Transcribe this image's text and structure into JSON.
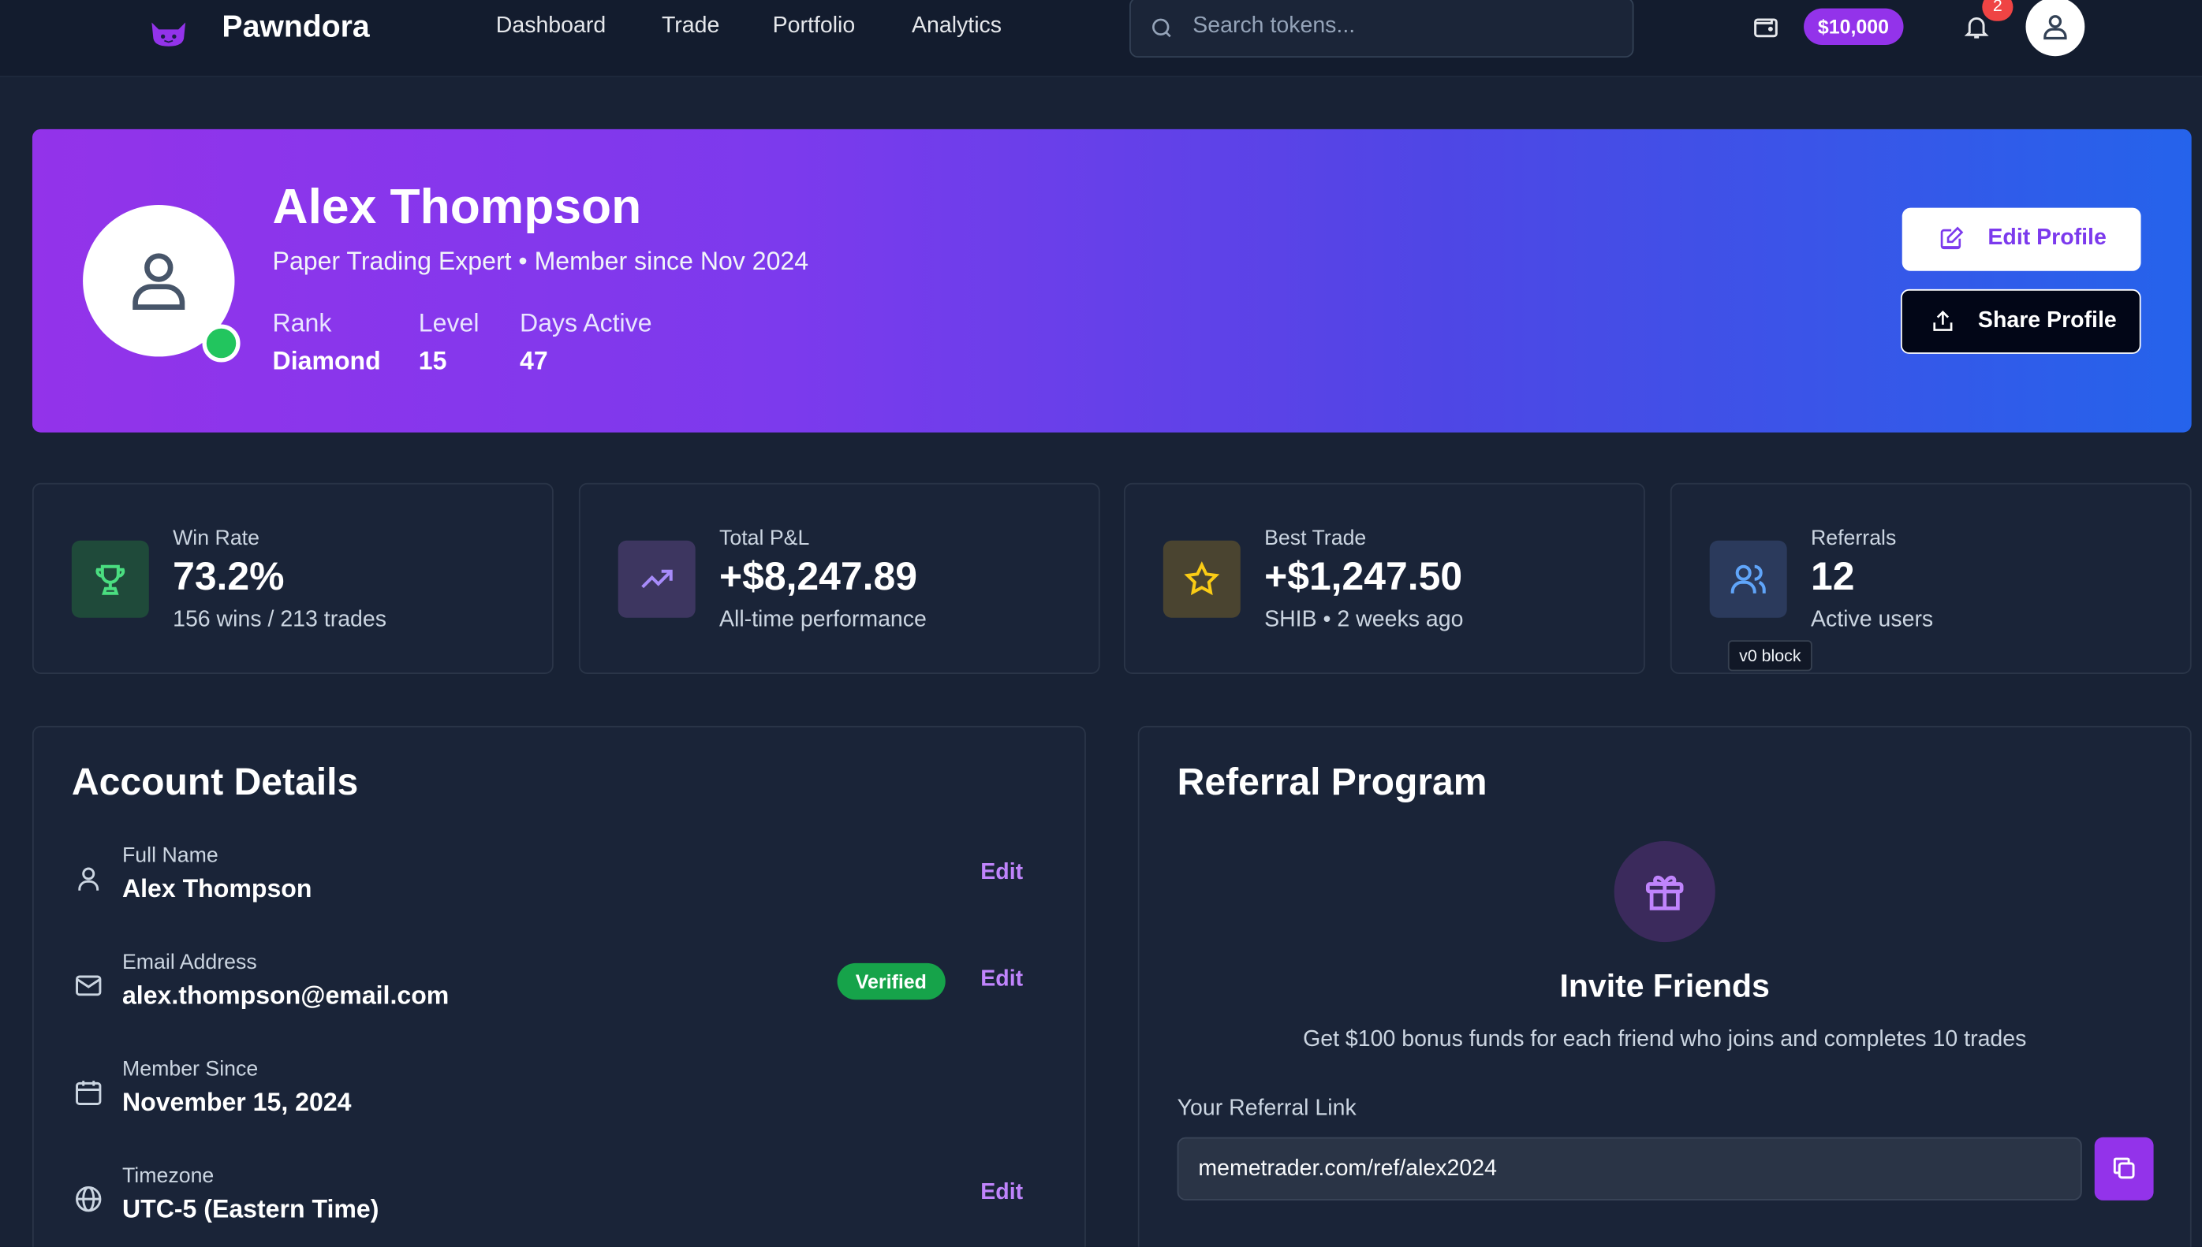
{
  "nav": {
    "brand": "Pawndora",
    "links": [
      "Dashboard",
      "Trade",
      "Portfolio",
      "Analytics"
    ],
    "search_placeholder": "Search tokens...",
    "balance": "$10,000",
    "notification_count": "2"
  },
  "hero": {
    "name": "Alex Thompson",
    "subtitle": "Paper Trading Expert • Member since Nov 2024",
    "stats": [
      {
        "label": "Rank",
        "value": "Diamond"
      },
      {
        "label": "Level",
        "value": "15"
      },
      {
        "label": "Days Active",
        "value": "47"
      }
    ],
    "edit_label": "Edit Profile",
    "share_label": "Share Profile"
  },
  "cards": [
    {
      "label": "Win Rate",
      "value": "73.2%",
      "sub": "156 wins / 213 trades",
      "icon": "trophy-icon",
      "color": "#4ade80"
    },
    {
      "label": "Total P&L",
      "value": "+$8,247.89",
      "sub": "All-time performance",
      "icon": "trending-up-icon",
      "color": "#a78bfa"
    },
    {
      "label": "Best Trade",
      "value": "+$1,247.50",
      "sub": "SHIB • 2 weeks ago",
      "icon": "star-icon",
      "color": "#facc15"
    },
    {
      "label": "Referrals",
      "value": "12",
      "sub": "Active users",
      "icon": "users-icon",
      "color": "#60a5fa"
    }
  ],
  "tooltip": "v0 block",
  "account": {
    "title": "Account Details",
    "rows": [
      {
        "label": "Full Name",
        "value": "Alex Thompson",
        "edit": "Edit"
      },
      {
        "label": "Email Address",
        "value": "alex.thompson@email.com",
        "badge": "Verified",
        "edit": "Edit"
      },
      {
        "label": "Member Since",
        "value": "November 15, 2024"
      },
      {
        "label": "Timezone",
        "value": "UTC-5 (Eastern Time)",
        "edit": "Edit"
      }
    ]
  },
  "referral": {
    "title": "Referral Program",
    "invite_title": "Invite Friends",
    "invite_sub": "Get $100 bonus funds for each friend who joins and completes 10 trades",
    "link_label": "Your Referral Link",
    "link_value": "memetrader.com/ref/alex2024"
  },
  "colors": {
    "accent": "#9333ea",
    "success": "#22c55e",
    "danger": "#ef4444"
  }
}
